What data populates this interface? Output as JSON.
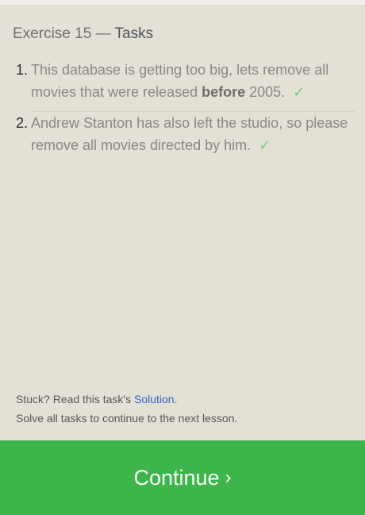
{
  "header": {
    "exercise": "Exercise 15",
    "separator": "—",
    "tasks_label": "Tasks"
  },
  "tasks": [
    {
      "number": "1.",
      "text_before": "This database is getting too big, lets remove all movies that were released ",
      "bold": "before",
      "text_after": " 2005.",
      "status_icon": "checkmark-icon"
    },
    {
      "number": "2.",
      "text": "Andrew Stanton has also left the studio, so please remove all movies directed by him.",
      "status_icon": "checkmark-icon"
    }
  ],
  "check_glyph": "✓",
  "footer": {
    "stuck_prefix": "Stuck? Read this task's ",
    "solution_link": "Solution",
    "stuck_suffix": ".",
    "note": "Solve all tasks to continue to the next lesson."
  },
  "continue_button": {
    "label": "Continue",
    "chevron": "›"
  },
  "colors": {
    "panel_background": "#e3e0d6",
    "continue_green": "#3cb64a",
    "check_green": "#76c87a",
    "link_blue": "#2f62c9"
  }
}
